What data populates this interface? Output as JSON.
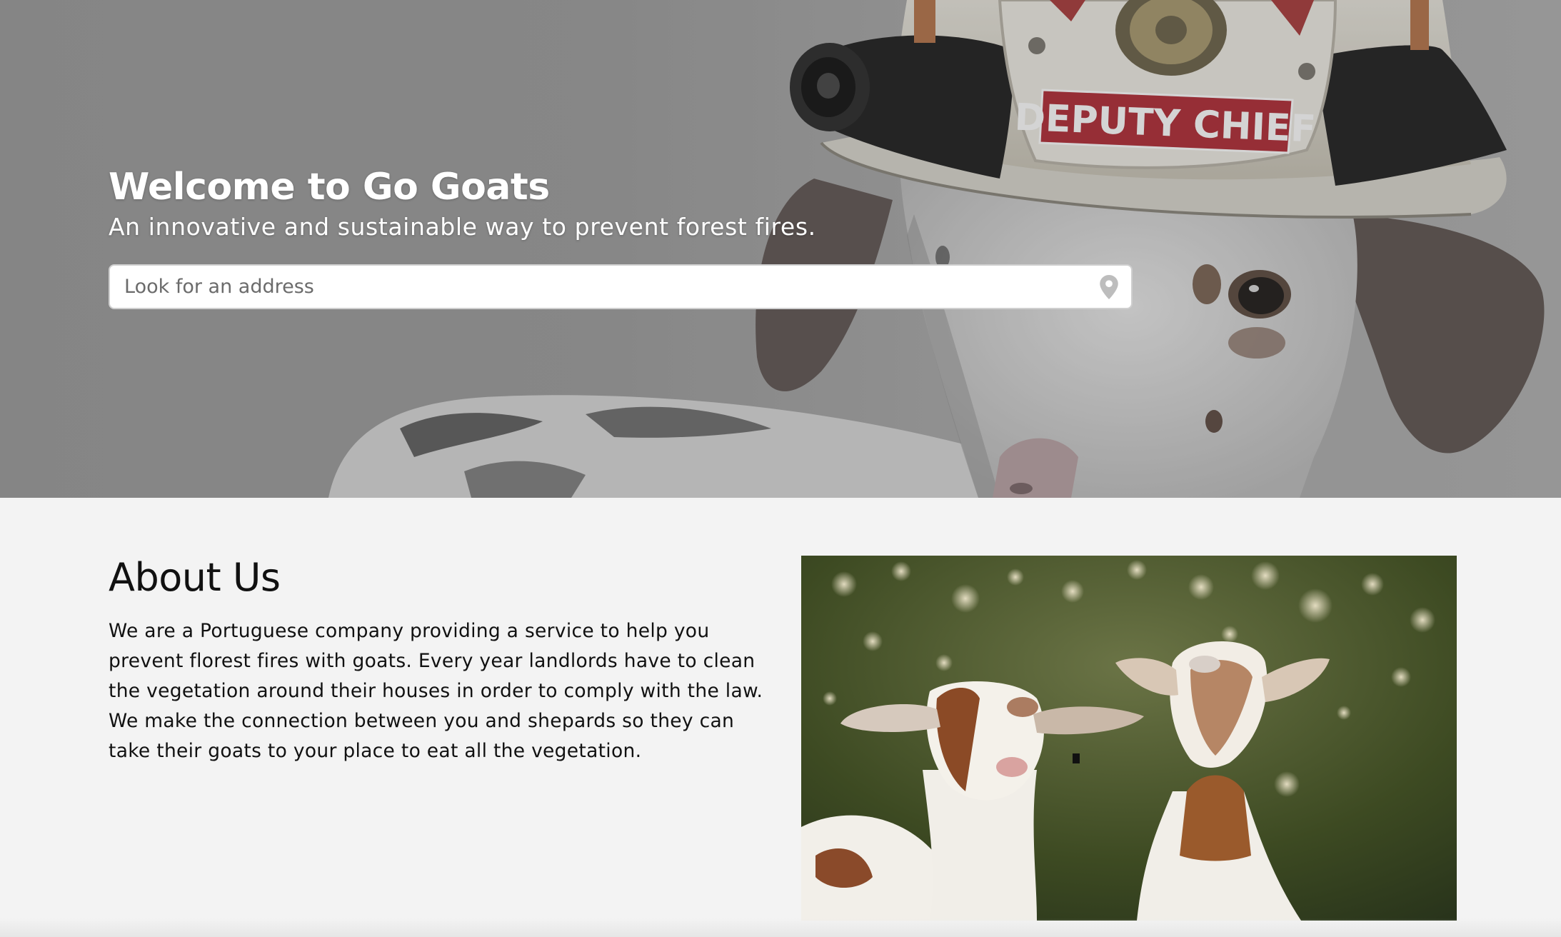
{
  "hero": {
    "title": "Welcome to Go Goats",
    "subtitle": "An innovative and sustainable way to prevent forest fires.",
    "search": {
      "placeholder": "Look for an address",
      "value": "",
      "icon": "map-pin-icon"
    },
    "helmet_badge_text": "DEPUTY CHIEF",
    "image_subject": "goat-wearing-fire-helmet"
  },
  "about": {
    "title": "About Us",
    "body": "We are a Portuguese company providing a service to help you prevent florest fires with goats. Every year landlords have to clean the vegetation around their houses in order to comply with the law. We make the connection between you and shepards so they can take their goats to your place to eat all the vegetation.",
    "image_subject": "two-goats-in-forest"
  },
  "colors": {
    "hero_overlay": "#9d9d9d",
    "hero_text": "#ffffff",
    "page_background": "#f3f3f3",
    "body_text": "#111111",
    "search_border": "#cfcfcf",
    "pin_icon": "#bdbdbd"
  }
}
